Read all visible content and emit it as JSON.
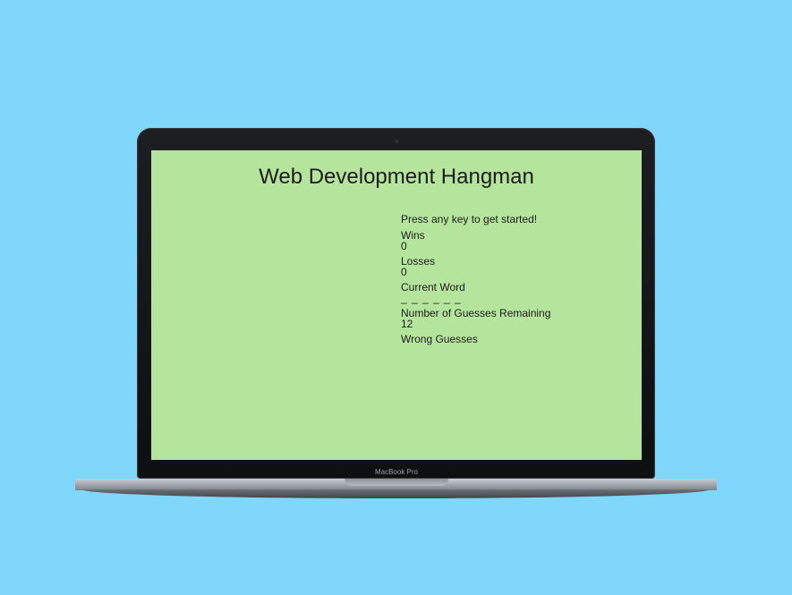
{
  "device": {
    "label": "MacBook Pro"
  },
  "page": {
    "title": "Web Development Hangman"
  },
  "game": {
    "prompt": "Press any key to get started!",
    "wins_label": "Wins",
    "wins_value": "0",
    "losses_label": "Losses",
    "losses_value": "0",
    "current_word_label": "Current Word",
    "current_word_value": "_ _ _ _ _ _",
    "guesses_remaining_label": "Number of Guesses Remaining",
    "guesses_remaining_value": "12",
    "wrong_guesses_label": "Wrong Guesses",
    "wrong_guesses_value": ""
  },
  "colors": {
    "background": "#7fd8fc",
    "screen": "#b5e59c",
    "text": "#1c1c1c"
  }
}
